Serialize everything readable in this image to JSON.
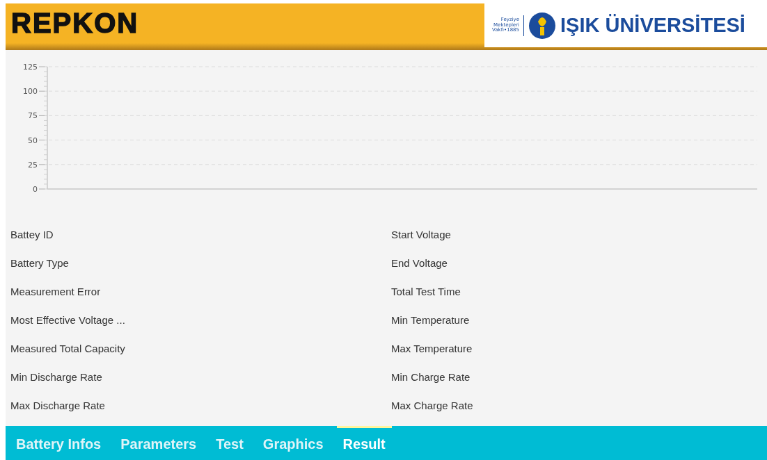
{
  "header": {
    "brand": "REPKON",
    "university": {
      "foundation": "Feyziye Mektepleri Vakfı•1885",
      "name": "IŞIK ÜNİVERSİTESİ"
    }
  },
  "chart": {
    "y_tick_labels": [
      "125",
      "100",
      "75",
      "50",
      "25",
      "0"
    ]
  },
  "fields_left": [
    "Battey ID",
    "Battery Type",
    "Measurement Error",
    "Most Effective Voltage ...",
    "Measured Total Capacity",
    "Min Discharge Rate",
    "Max Discharge Rate"
  ],
  "fields_right": [
    "Start Voltage",
    "End Voltage",
    "Total Test Time",
    "Min Temperature",
    "Max Temperature",
    "Min Charge Rate",
    "Max Charge Rate"
  ],
  "tabs": [
    {
      "label": "Battery Infos",
      "selected": false
    },
    {
      "label": "Parameters",
      "selected": false
    },
    {
      "label": "Test",
      "selected": false
    },
    {
      "label": "Graphics",
      "selected": false
    },
    {
      "label": "Result",
      "selected": true
    }
  ]
}
